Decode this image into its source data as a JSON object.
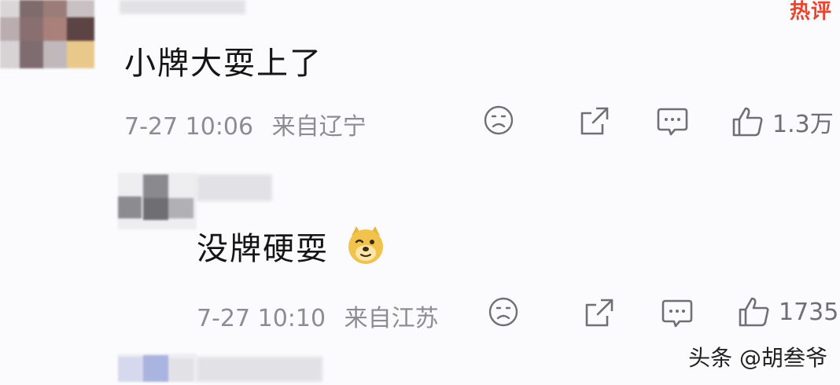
{
  "top_badge": "热评",
  "comments": [
    {
      "text": "小牌大耍上了",
      "time": "7-27 10:06",
      "location": "来自辽宁",
      "likes": "1.3万"
    },
    {
      "text": "没牌硬耍",
      "time": "7-27 10:10",
      "location": "来自江苏",
      "likes": "1735"
    }
  ],
  "icons": {
    "dislike": "sad-face-icon",
    "share": "share-icon",
    "reply": "comment-icon",
    "like": "thumbs-up-icon",
    "emoji": "doge-emoji-icon"
  },
  "watermark": "头条 @胡叁爷"
}
